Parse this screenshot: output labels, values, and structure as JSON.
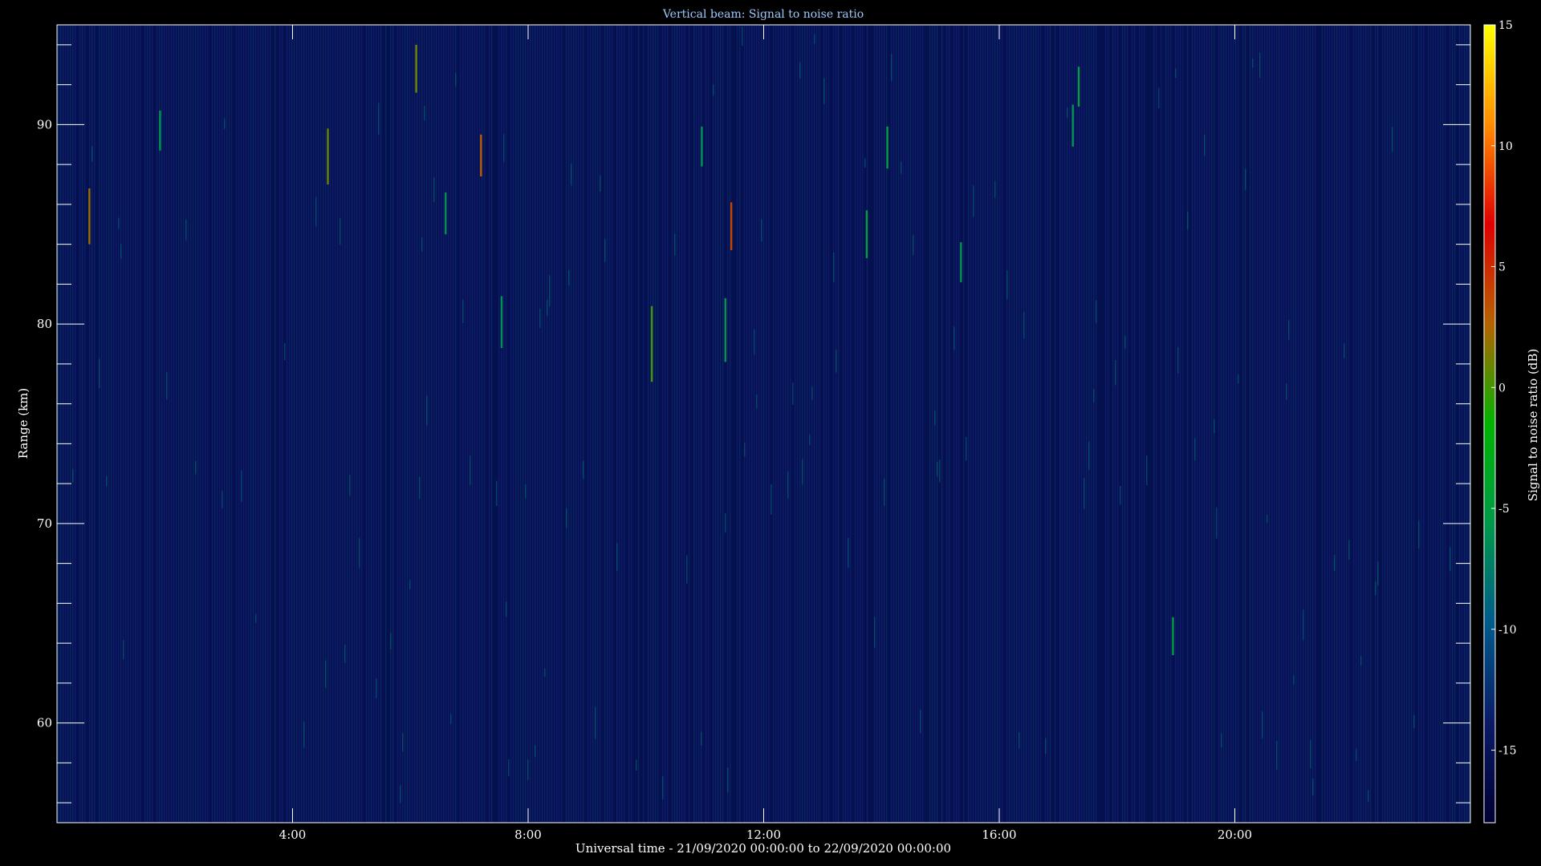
{
  "chart_data": {
    "type": "heatmap",
    "title": "Vertical beam: Signal to noise ratio",
    "xlabel": "Universal time - 21/09/2020 00:00:00 to 22/09/2020 00:00:00",
    "ylabel": "Range (km)",
    "colorbar_label": "Signal to noise ratio (dB)",
    "xlim": [
      0,
      24
    ],
    "ylim": [
      55,
      95
    ],
    "clim": [
      -18,
      15
    ],
    "x_ticks": [
      {
        "value": 4,
        "label": "4:00"
      },
      {
        "value": 8,
        "label": "8:00"
      },
      {
        "value": 12,
        "label": "12:00"
      },
      {
        "value": 16,
        "label": "16:00"
      },
      {
        "value": 20,
        "label": "20:00"
      }
    ],
    "y_ticks": [
      {
        "value": 60,
        "label": "60"
      },
      {
        "value": 70,
        "label": "70"
      },
      {
        "value": 80,
        "label": "80"
      },
      {
        "value": 90,
        "label": "90"
      }
    ],
    "colorbar_ticks": [
      {
        "value": 15,
        "label": "15"
      },
      {
        "value": 10,
        "label": "10"
      },
      {
        "value": 5,
        "label": "5"
      },
      {
        "value": 0,
        "label": "0"
      },
      {
        "value": -5,
        "label": "-5"
      },
      {
        "value": -10,
        "label": "-10"
      },
      {
        "value": -15,
        "label": "-15"
      }
    ],
    "colorscale": [
      "#000033",
      "#0a1a66",
      "#005a8c",
      "#009a4a",
      "#00b400",
      "#b46400",
      "#e00000",
      "#ff8c00",
      "#ffff00"
    ],
    "background_snr": -15.5,
    "features": [
      {
        "time": 0.55,
        "range_min": 84.0,
        "range_max": 86.8,
        "snr": 2
      },
      {
        "time": 1.75,
        "range_min": 88.7,
        "range_max": 90.7,
        "snr": -6
      },
      {
        "time": 4.6,
        "range_min": 87.0,
        "range_max": 89.8,
        "snr": 1
      },
      {
        "time": 6.1,
        "range_min": 91.6,
        "range_max": 94.0,
        "snr": 1
      },
      {
        "time": 6.6,
        "range_min": 84.5,
        "range_max": 86.6,
        "snr": -6
      },
      {
        "time": 7.2,
        "range_min": 87.4,
        "range_max": 89.5,
        "snr": 3
      },
      {
        "time": 7.55,
        "range_min": 78.8,
        "range_max": 81.4,
        "snr": -6
      },
      {
        "time": 10.1,
        "range_min": 77.1,
        "range_max": 80.9,
        "snr": 0
      },
      {
        "time": 10.95,
        "range_min": 87.9,
        "range_max": 89.9,
        "snr": -6
      },
      {
        "time": 11.35,
        "range_min": 78.1,
        "range_max": 81.3,
        "snr": -6
      },
      {
        "time": 11.45,
        "range_min": 83.7,
        "range_max": 86.1,
        "snr": 4
      },
      {
        "time": 13.75,
        "range_min": 83.3,
        "range_max": 85.7,
        "snr": -5
      },
      {
        "time": 14.1,
        "range_min": 87.8,
        "range_max": 89.9,
        "snr": -5
      },
      {
        "time": 15.35,
        "range_min": 82.1,
        "range_max": 84.1,
        "snr": -6
      },
      {
        "time": 17.25,
        "range_min": 88.9,
        "range_max": 91.0,
        "snr": -6
      },
      {
        "time": 17.35,
        "range_min": 90.9,
        "range_max": 92.9,
        "snr": -5
      },
      {
        "time": 18.95,
        "range_min": 63.4,
        "range_max": 65.3,
        "snr": -5
      }
    ]
  }
}
